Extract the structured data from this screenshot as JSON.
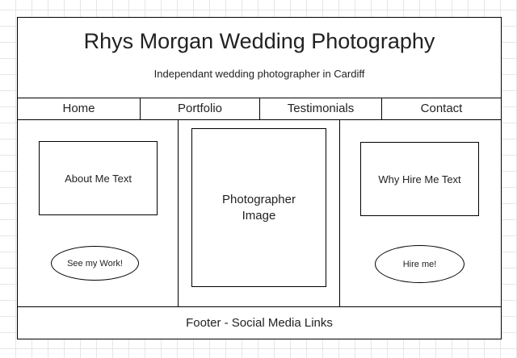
{
  "header": {
    "title": "Rhys Morgan Wedding Photography",
    "subtitle": "Independant wedding photographer in Cardiff"
  },
  "nav": {
    "items": [
      "Home",
      "Portfolio",
      "Testimonials",
      "Contact"
    ]
  },
  "left_column": {
    "text_box": "About Me Text",
    "button": "See my Work!"
  },
  "center_column": {
    "image_box": "Photographer Image"
  },
  "right_column": {
    "text_box": "Why Hire Me Text",
    "button": "Hire me!"
  },
  "footer": {
    "text": "Footer - Social Media Links"
  }
}
